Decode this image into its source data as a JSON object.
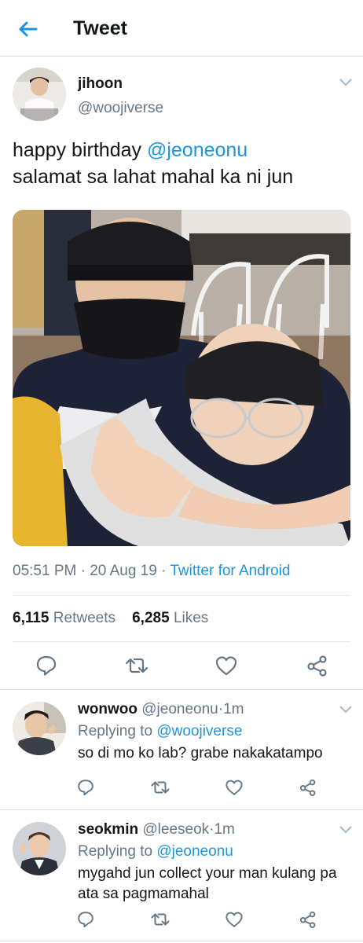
{
  "header": {
    "title": "Tweet"
  },
  "tweet": {
    "display_name": "jihoon",
    "handle": "@woojiverse",
    "text_line1_prefix": "happy birthday ",
    "text_line1_mention": "@jeoneonu",
    "text_line2": "salamat sa lahat mahal ka ni jun",
    "time": "05:51 PM",
    "date": "20 Aug 19",
    "source": "Twitter for Android",
    "retweets_count": "6,115",
    "retweets_label": "Retweets",
    "likes_count": "6,285",
    "likes_label": "Likes"
  },
  "replies": [
    {
      "display_name": "wonwoo",
      "handle": "@jeoneonu",
      "time": "1m",
      "replying_prefix": "Replying to",
      "replying_to": "@woojiverse",
      "text": "so di mo ko lab? grabe nakakatampo"
    },
    {
      "display_name": "seokmin",
      "handle": "@leeseok",
      "time": "1m",
      "replying_prefix": "Replying to",
      "replying_to": "@jeoneonu",
      "text": "mygahd jun collect your man kulang pa ata sa pagmamahal"
    }
  ],
  "separator": "·",
  "colors": {
    "accent": "#1b95e0",
    "muted": "#657786",
    "text": "#14171a",
    "icon": "#657786"
  }
}
